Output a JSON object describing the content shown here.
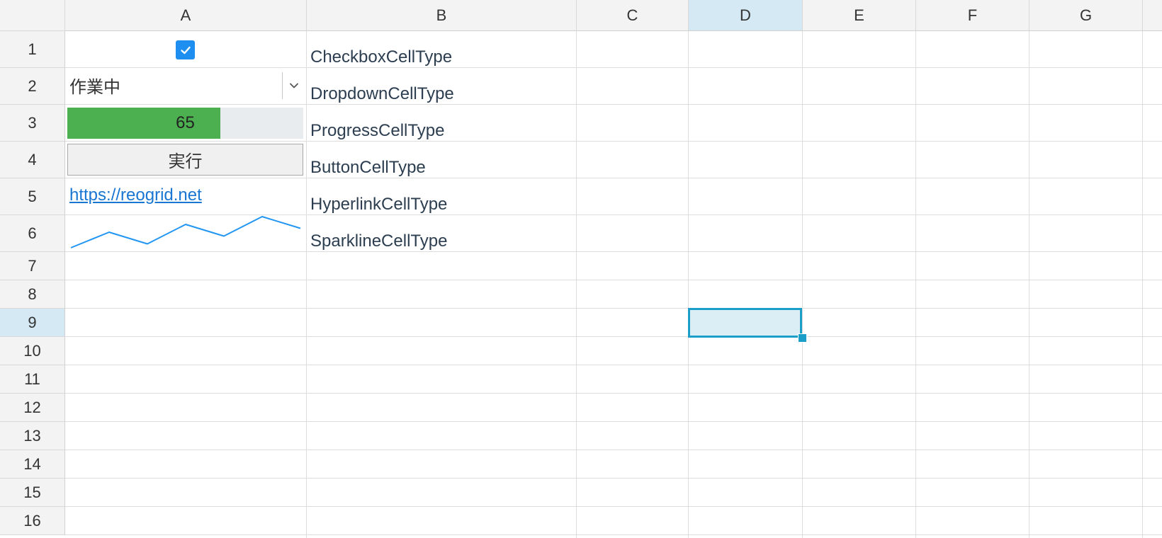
{
  "columns": [
    "A",
    "B",
    "C",
    "D",
    "E",
    "F",
    "G"
  ],
  "rows": [
    "1",
    "2",
    "3",
    "4",
    "5",
    "6",
    "7",
    "8",
    "9",
    "10",
    "11",
    "12",
    "13",
    "14",
    "15",
    "16"
  ],
  "selected_column": "D",
  "selected_row": "9",
  "cells": {
    "checkbox": {
      "checked": true
    },
    "dropdown": {
      "value": "作業中"
    },
    "progress": {
      "value": 65,
      "label": "65",
      "max": 100
    },
    "button": {
      "label": "実行"
    },
    "hyperlink": {
      "text": "https://reogrid.net"
    },
    "sparkline": {
      "values": [
        0,
        4,
        1,
        6,
        3,
        8,
        5
      ]
    }
  },
  "labels": {
    "b1": "CheckboxCellType",
    "b2": "DropdownCellType",
    "b3": "ProgressCellType",
    "b4": "ButtonCellType",
    "b5": "HyperlinkCellType",
    "b6": "SparklineCellType"
  },
  "colors": {
    "accent": "#1b9fc8",
    "checkbox": "#1f8ef1",
    "progress_fill": "#4caf50",
    "link": "#1976d2",
    "sparkline": "#2196f3"
  }
}
